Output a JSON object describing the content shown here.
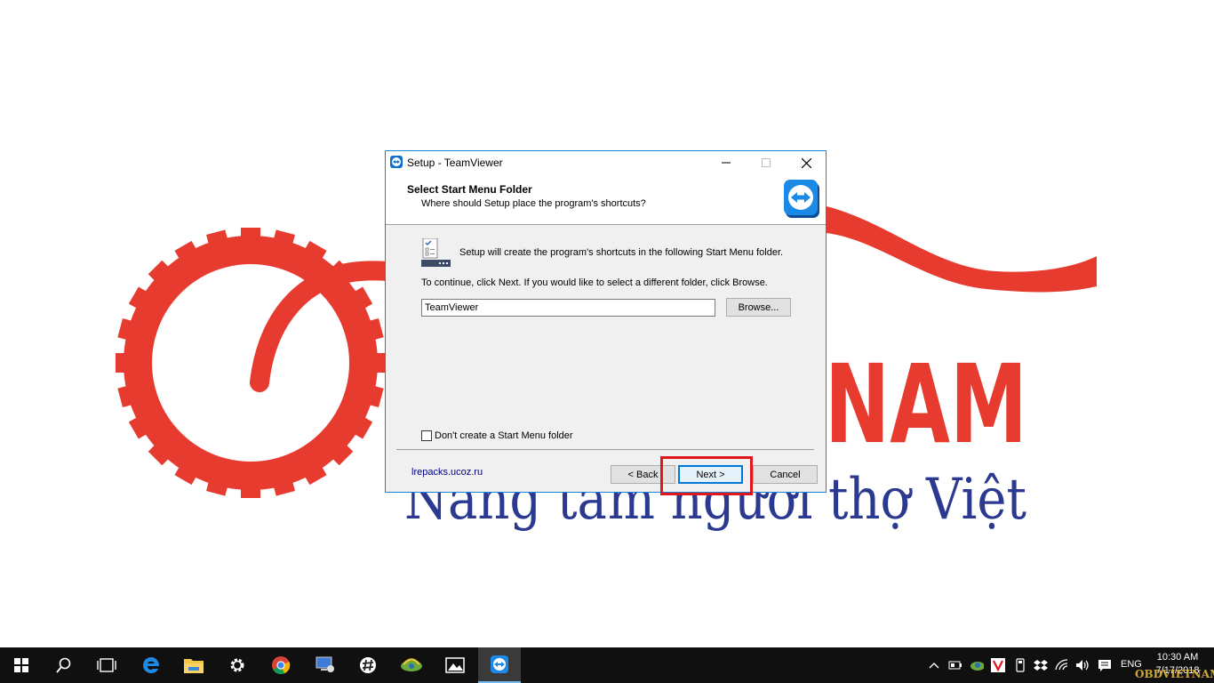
{
  "wallpaper": {
    "brand_fragment": "NAM",
    "slogan": "Nâng tầm người thợ Việt",
    "colors": {
      "red": "#e63b2e",
      "navy": "#2b3990"
    }
  },
  "dialog": {
    "title": "Setup - TeamViewer",
    "header_title": "Select Start Menu Folder",
    "header_subtitle": "Where should Setup place the program's shortcuts?",
    "intro_text": "Setup will create the program's shortcuts in the following Start Menu folder.",
    "continue_text": "To continue, click Next. If you would like to select a different folder, click Browse.",
    "folder_value": "TeamViewer",
    "browse_label": "Browse...",
    "checkbox_label": "Don't create a Start Menu folder",
    "checkbox_checked": false,
    "site_link": "lrepacks.ucoz.ru",
    "back_label": "< Back",
    "next_label": "Next >",
    "cancel_label": "Cancel",
    "highlight_color": "#e0161d"
  },
  "taskbar": {
    "apps": [
      "start-icon",
      "search-icon",
      "task-view-icon",
      "edge-icon",
      "file-explorer-icon",
      "settings-icon",
      "chrome-icon",
      "remote-desktop-icon",
      "slack-icon",
      "network-map-icon",
      "photos-icon",
      "teamviewer-icon"
    ],
    "language": "ENG",
    "time": "10:30 AM",
    "date": "7/17/2018"
  },
  "watermark": "OBDVIETNAM"
}
